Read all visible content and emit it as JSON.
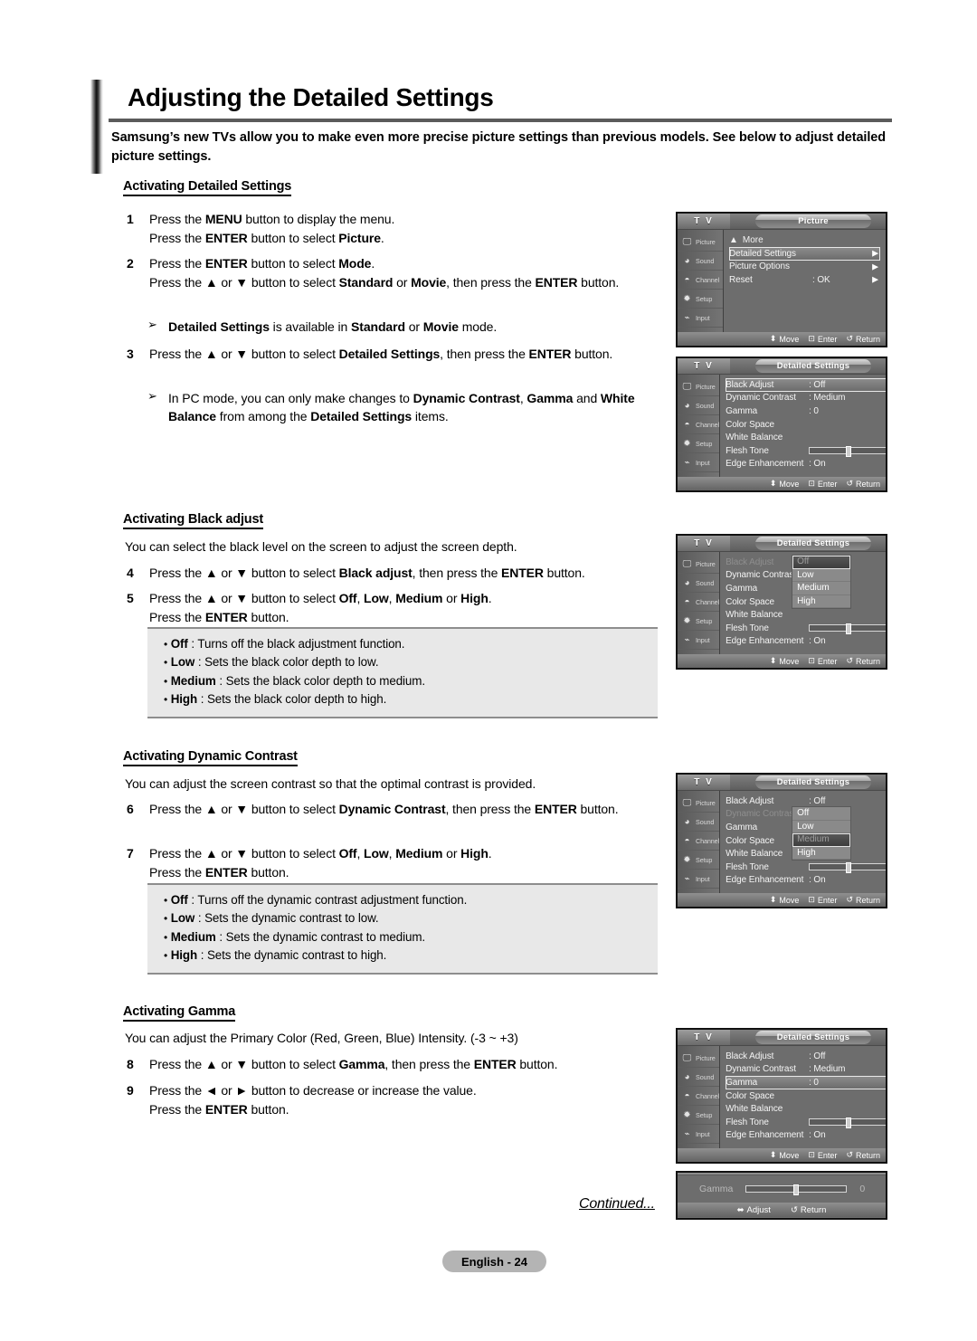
{
  "document": {
    "title": "Adjusting the Detailed Settings",
    "intro": "Samsung’s new TVs allow you to make even more precise picture settings than previous models. See below to adjust detailed picture settings.",
    "continued": "Continued...",
    "page_label": "English - 24"
  },
  "sections": {
    "detailed": {
      "heading": "Activating Detailed Settings",
      "steps": [
        {
          "num": "1",
          "lines": [
            "Press the MENU button to display the menu.",
            "Press the ENTER button to select Picture."
          ]
        },
        {
          "num": "2",
          "lines": [
            "Press the ENTER button to select Mode.",
            "Press the ▲ or ▼ button to select Standard or Movie, then press the ENTER button."
          ]
        },
        {
          "num": "3",
          "lines": [
            "Press the ▲ or ▼ button to select Detailed Settings, then press the ENTER button."
          ]
        }
      ],
      "note1": "Detailed Settings is available in Standard or Movie mode.",
      "note2": "In PC mode, you can only make changes to Dynamic Contrast, Gamma and White Balance from among the Detailed Settings items."
    },
    "black_adjust": {
      "heading": "Activating Black adjust",
      "desc": "You can select the black level on the screen to adjust the screen depth.",
      "steps": [
        {
          "num": "4",
          "lines": [
            "Press the ▲ or ▼ button to select Black adjust, then press the ENTER button."
          ]
        },
        {
          "num": "5",
          "lines": [
            "Press the ▲ or ▼ button to select Off, Low, Medium or High.",
            "Press the ENTER button."
          ]
        }
      ],
      "bullets": [
        {
          "term": "Off",
          "desc": ": Turns off the black adjustment function."
        },
        {
          "term": "Low",
          "desc": ": Sets the black color depth to low."
        },
        {
          "term": "Medium",
          "desc": ": Sets the black color depth to medium."
        },
        {
          "term": "High",
          "desc": ": Sets the black color depth to high."
        }
      ]
    },
    "dynamic_contrast": {
      "heading": "Activating Dynamic Contrast",
      "desc": "You can adjust the screen contrast so that the optimal contrast is provided.",
      "steps": [
        {
          "num": "6",
          "lines": [
            "Press the ▲ or ▼ button to select Dynamic Contrast, then press the ENTER button."
          ]
        },
        {
          "num": "7",
          "lines": [
            "Press the ▲ or ▼ button to select Off, Low, Medium or High.",
            "Press the ENTER button."
          ]
        }
      ],
      "bullets": [
        {
          "term": "Off",
          "desc": ": Turns off the dynamic contrast adjustment function."
        },
        {
          "term": "Low",
          "desc": ": Sets the dynamic contrast to low."
        },
        {
          "term": "Medium",
          "desc": ": Sets the dynamic contrast to medium."
        },
        {
          "term": "High",
          "desc": ": Sets the dynamic contrast to high."
        }
      ]
    },
    "gamma": {
      "heading": "Activating Gamma",
      "desc": "You can adjust the Primary Color (Red, Green, Blue) Intensity. (-3 ~ +3)",
      "steps": [
        {
          "num": "8",
          "lines": [
            "Press the ▲ or ▼ button to select Gamma, then press the ENTER button."
          ]
        },
        {
          "num": "9",
          "lines": [
            "Press the ◄ or ► button to decrease or increase the value.",
            "Press the ENTER button."
          ]
        }
      ]
    }
  },
  "osd": {
    "tv_label": "T V",
    "sidebar": [
      {
        "label": "Picture",
        "icon": "picture-icon"
      },
      {
        "label": "Sound",
        "icon": "sound-icon"
      },
      {
        "label": "Channel",
        "icon": "channel-icon"
      },
      {
        "label": "Setup",
        "icon": "setup-icon"
      },
      {
        "label": "Input",
        "icon": "input-icon"
      }
    ],
    "footer": {
      "move": "Move",
      "enter": "Enter",
      "return": "Return"
    },
    "menu1": {
      "title": "Picture",
      "more": "More",
      "rows": [
        {
          "label": "Detailed Settings",
          "value": "",
          "selected": true,
          "arrow": true
        },
        {
          "label": "Picture Options",
          "value": "",
          "selected": false,
          "arrow": true
        },
        {
          "label": "Reset",
          "value": ": OK",
          "selected": false,
          "arrow": true
        }
      ]
    },
    "menu2": {
      "title": "Detailed Settings",
      "rows": [
        {
          "label": "Black Adjust",
          "value": ": Off",
          "selected": true,
          "arrow": true
        },
        {
          "label": "Dynamic Contrast",
          "value": ": Medium",
          "selected": false,
          "arrow": true
        },
        {
          "label": "Gamma",
          "value": ": 0",
          "selected": false,
          "arrow": true
        },
        {
          "label": "Color Space",
          "value": "",
          "selected": false,
          "arrow": true
        },
        {
          "label": "White Balance",
          "value": "",
          "selected": false,
          "arrow": true
        },
        {
          "label": "Flesh Tone",
          "value": "",
          "slider": true,
          "slider_value": "0",
          "selected": false,
          "arrow": false
        },
        {
          "label": "Edge Enhancement",
          "value": ": On",
          "selected": false,
          "arrow": true
        }
      ]
    },
    "menu3": {
      "title": "Detailed Settings",
      "rows": [
        {
          "label": "Black Adjust",
          "value": ":",
          "dim": true,
          "arrow": false
        },
        {
          "label": "Dynamic Contrast",
          "value": ":",
          "dim": false,
          "arrow": false
        },
        {
          "label": "Gamma",
          "value": ":",
          "dim": false,
          "arrow": false
        },
        {
          "label": "Color Space",
          "value": "",
          "dim": false,
          "arrow": false
        },
        {
          "label": "White Balance",
          "value": "",
          "dim": false,
          "arrow": false
        },
        {
          "label": "Flesh Tone",
          "value": "",
          "slider": true,
          "slider_value": "0",
          "dim": false,
          "arrow": false
        },
        {
          "label": "Edge Enhancement",
          "value": ": On",
          "dim": false,
          "arrow": false
        }
      ],
      "dropdown": {
        "options": [
          "Off",
          "Low",
          "Medium",
          "High"
        ],
        "current": "Off"
      }
    },
    "menu4": {
      "title": "Detailed Settings",
      "rows": [
        {
          "label": "Black Adjust",
          "value": ": Off",
          "dim": false,
          "arrow": false
        },
        {
          "label": "Dynamic Contrast",
          "value": ":",
          "dim": true,
          "arrow": false
        },
        {
          "label": "Gamma",
          "value": ":",
          "dim": false,
          "arrow": false
        },
        {
          "label": "Color Space",
          "value": "",
          "dim": false,
          "arrow": false
        },
        {
          "label": "White Balance",
          "value": "",
          "dim": false,
          "arrow": false
        },
        {
          "label": "Flesh Tone",
          "value": "",
          "slider": true,
          "slider_value": "0",
          "dim": false,
          "arrow": false
        },
        {
          "label": "Edge Enhancement",
          "value": ": On",
          "dim": false,
          "arrow": false
        }
      ],
      "dropdown": {
        "options": [
          "Off",
          "Low",
          "Medium",
          "High"
        ],
        "current": "Medium"
      }
    },
    "menu5": {
      "title": "Detailed Settings",
      "rows": [
        {
          "label": "Black Adjust",
          "value": ": Off",
          "selected": false,
          "arrow": true
        },
        {
          "label": "Dynamic Contrast",
          "value": ": Medium",
          "selected": false,
          "arrow": true
        },
        {
          "label": "Gamma",
          "value": ": 0",
          "selected": true,
          "arrow": true
        },
        {
          "label": "Color Space",
          "value": "",
          "selected": false,
          "arrow": true
        },
        {
          "label": "White Balance",
          "value": "",
          "selected": false,
          "arrow": true
        },
        {
          "label": "Flesh Tone",
          "value": "",
          "slider": true,
          "slider_value": "0",
          "selected": false,
          "arrow": false
        },
        {
          "label": "Edge Enhancement",
          "value": ": On",
          "selected": false,
          "arrow": true
        }
      ]
    },
    "gamma_bar": {
      "label": "Gamma",
      "value": "0",
      "adjust": "Adjust",
      "return": "Return"
    }
  }
}
